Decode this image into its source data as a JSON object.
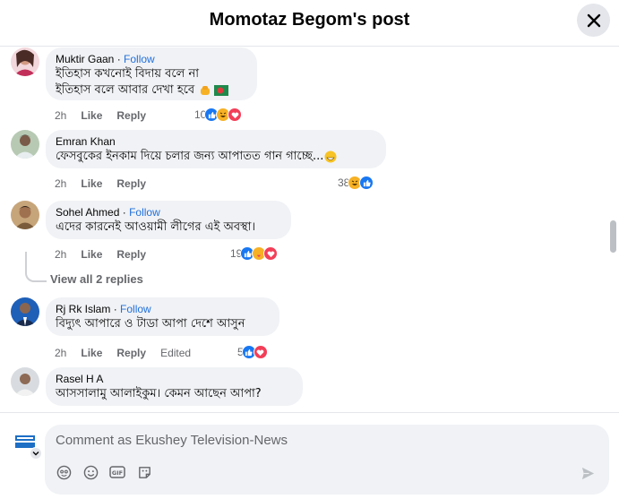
{
  "header": {
    "title": "Momotaz Begom's post"
  },
  "comments": [
    {
      "author": "Muktir Gaan",
      "follow": "Follow",
      "text_lines": [
        "ইতিহাস কখনোই বিদায় বলে না",
        "ইতিহাস বলে আবার দেখা হবে"
      ],
      "time": "2h",
      "like": "Like",
      "reply": "Reply",
      "reaction_count": "10",
      "reactions": [
        "like-icon",
        "haha-icon",
        "love-icon"
      ]
    },
    {
      "author": "Emran Khan",
      "text_lines": [
        "ফেসবুকের ইনকাম দিয়ে চলার জন্য আপাতত গান গাচ্ছে..."
      ],
      "time": "2h",
      "like": "Like",
      "reply": "Reply",
      "reaction_count": "38",
      "reactions": [
        "haha-icon",
        "like-icon"
      ]
    },
    {
      "author": "Sohel Ahmed",
      "follow": "Follow",
      "text_lines": [
        "এদের কারনেই আওয়ামী লীগের এই অবস্থা।"
      ],
      "time": "2h",
      "like": "Like",
      "reply": "Reply",
      "reaction_count": "19",
      "reactions": [
        "like-icon",
        "care-icon",
        "love-icon"
      ],
      "view_replies": "View all 2 replies"
    },
    {
      "author": "Rj Rk Islam",
      "follow": "Follow",
      "text_lines": [
        "বিদ্যুৎ আপারে ও টাডা আপা দেশে আসুন"
      ],
      "time": "2h",
      "like": "Like",
      "reply": "Reply",
      "edited": "Edited",
      "reaction_count": "5",
      "reactions": [
        "like-icon",
        "love-icon"
      ]
    },
    {
      "author": "Rasel H A",
      "text_lines": [
        "আসসালামু আলাইকুম। কেমন আছেন আপা?"
      ]
    }
  ],
  "composer": {
    "placeholder": "Comment as Ekushey Television-News"
  },
  "colors": {
    "accent": "#216fdb",
    "bubble": "#f0f2f5",
    "like": "#1877f2",
    "love": "#f33e58",
    "haha": "#f7b125"
  }
}
